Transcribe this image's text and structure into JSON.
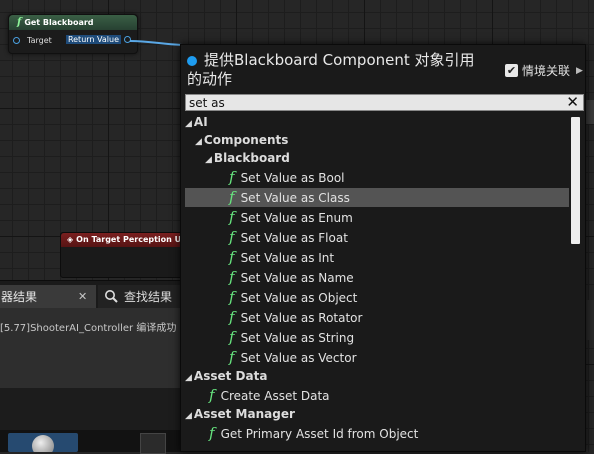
{
  "node": {
    "title": "Get Blackboard",
    "pin_target": "Target",
    "pin_return": "Return Value"
  },
  "perception_node": {
    "title": "On Target Perception Updated"
  },
  "bottom_panel": {
    "tab_results": "器结果",
    "tab_results_close": "✕",
    "tab_find": "查找结果",
    "message": "[5.77]ShooterAI_Controller 编译成功"
  },
  "menu": {
    "title": "提供Blackboard Component 对象引用的动作",
    "context_label": "情境关联",
    "context_checked": "✔",
    "search_value": "set as",
    "search_clear": "✕",
    "categories": {
      "ai": "AI",
      "components": "Components",
      "blackboard": "Blackboard",
      "asset_data": "Asset Data",
      "asset_manager": "Asset Manager"
    },
    "blackboard_items": [
      "Set Value as Bool",
      "Set Value as Class",
      "Set Value as Enum",
      "Set Value as Float",
      "Set Value as Int",
      "Set Value as Name",
      "Set Value as Object",
      "Set Value as Rotator",
      "Set Value as String",
      "Set Value as Vector"
    ],
    "selected_item": "Set Value as Class",
    "asset_data_item": "Create Asset Data",
    "asset_manager_item": "Get Primary Asset Id from Object"
  },
  "colors": {
    "accent": "#1e9cf0",
    "function_icon": "#67e47f",
    "selection": "#545454"
  },
  "icons": {
    "function": "f",
    "expand": "▲",
    "collapse": "◢"
  }
}
